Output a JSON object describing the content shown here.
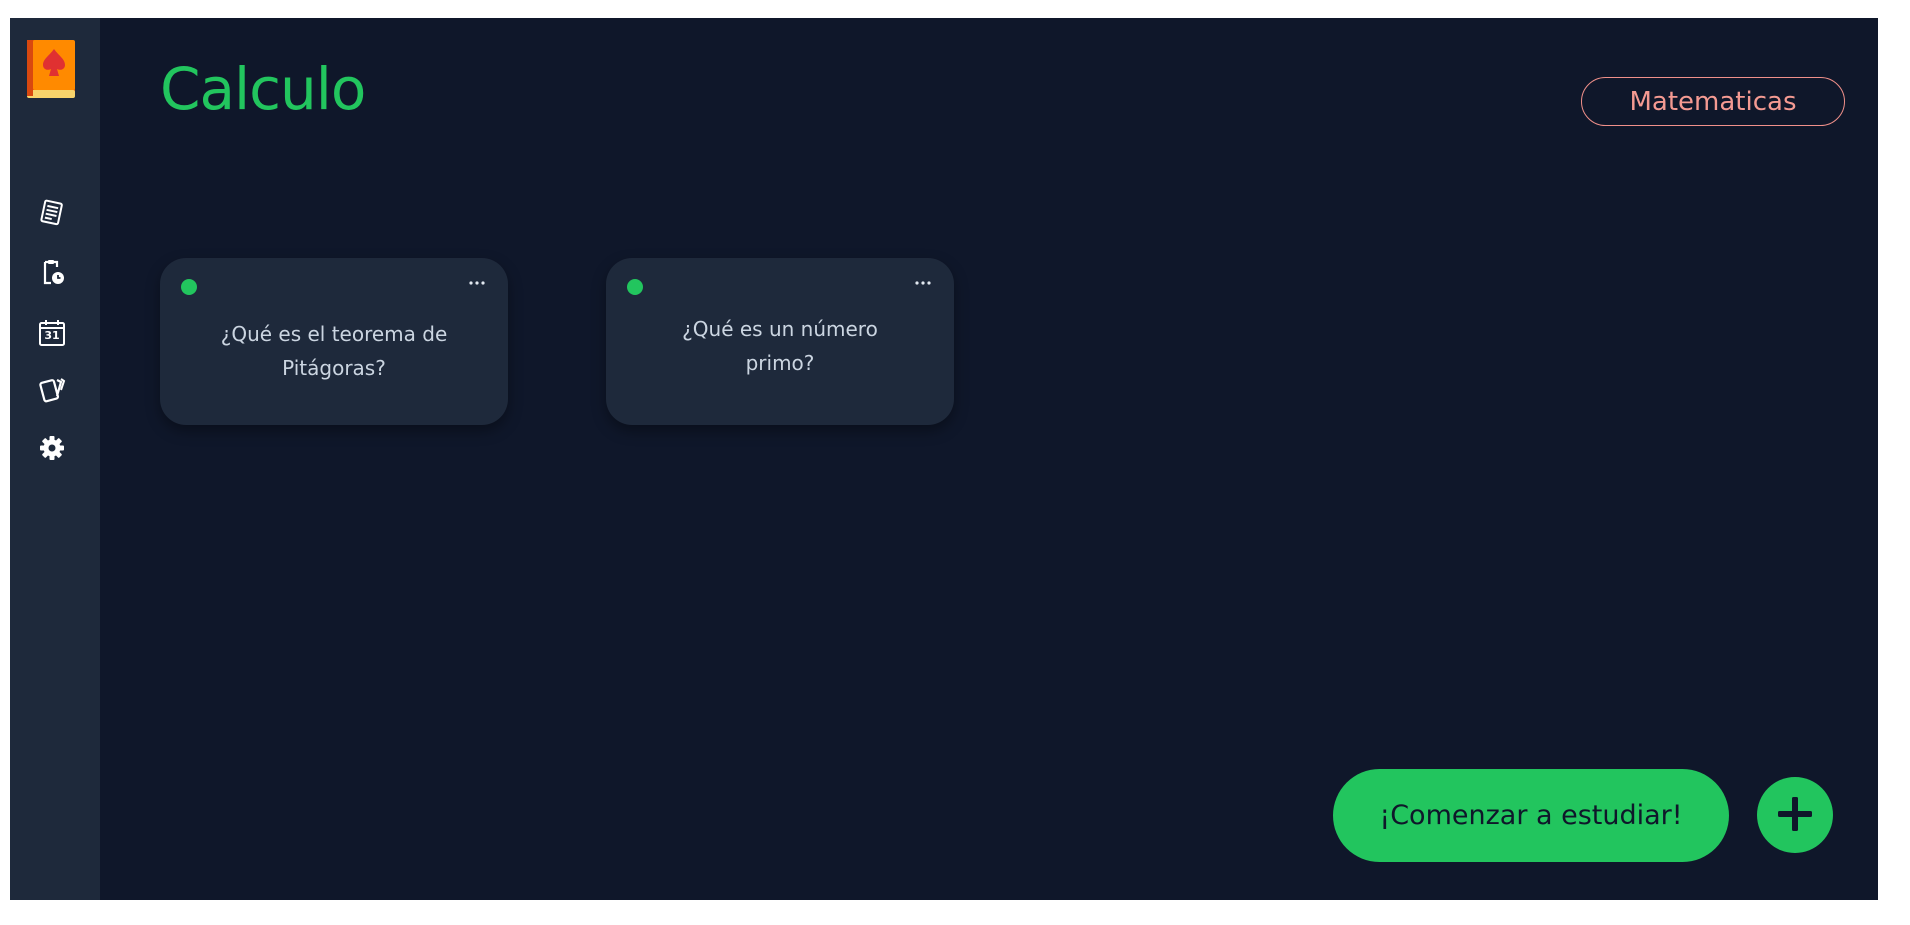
{
  "sidebar": {
    "logo_icon": "book-spade-logo-icon",
    "items": [
      {
        "icon": "notes-icon",
        "name": "sidebar-item-notes"
      },
      {
        "icon": "clipboard-clock-icon",
        "name": "sidebar-item-pending"
      },
      {
        "icon": "calendar-icon",
        "name": "sidebar-item-calendar",
        "day": "31"
      },
      {
        "icon": "cards-icon",
        "name": "sidebar-item-cards"
      },
      {
        "icon": "gear-icon",
        "name": "sidebar-item-settings"
      }
    ]
  },
  "header": {
    "title": "Calculo",
    "subject_badge": "Matematicas"
  },
  "cards": [
    {
      "question": "¿Qué es el teorema de Pitágoras?",
      "status_color": "#22c55e"
    },
    {
      "question": "¿Qué es un número primo?",
      "status_color": "#22c55e"
    }
  ],
  "actions": {
    "study_label": "¡Comenzar a estudiar!",
    "add_icon": "plus-icon"
  },
  "colors": {
    "background": "#0f172a",
    "sidebar": "#1e293b",
    "card": "#1e293b",
    "accent": "#22c55e",
    "badge": "#f49a92"
  }
}
